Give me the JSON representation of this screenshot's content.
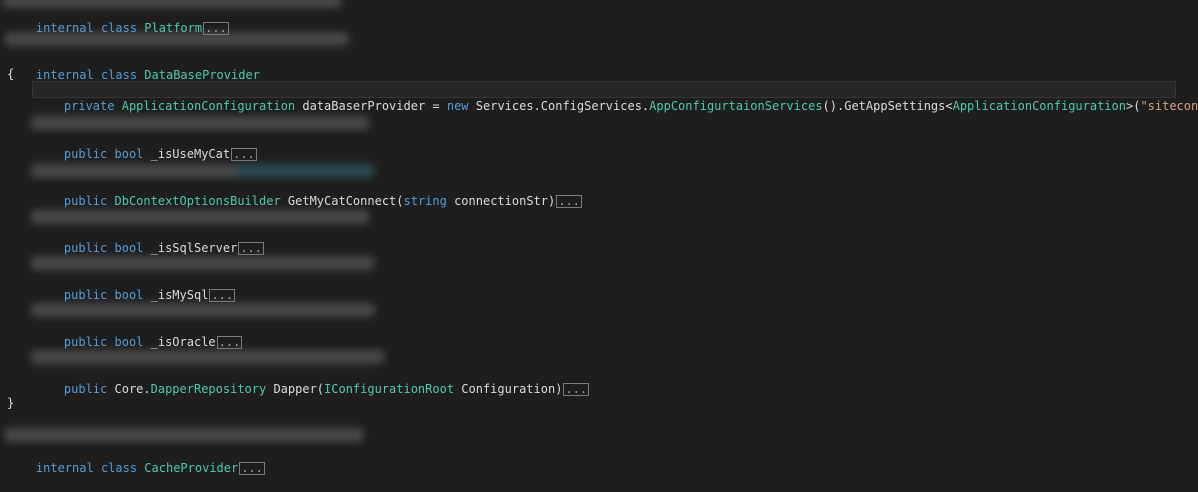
{
  "code": {
    "collapsed_marker": "...",
    "lines": {
      "platform": {
        "kw1": "internal",
        "kw2": "class",
        "name": "Platform"
      },
      "provider": {
        "kw1": "internal",
        "kw2": "class",
        "name": "DataBaseProvider"
      },
      "open_brace": "{",
      "field": {
        "kw": "private",
        "type": "ApplicationConfiguration",
        "var": "dataBaserProvider = ",
        "new_kw": "new",
        "ns": "Services.ConfigServices.",
        "cls": "AppConfigurtaionServices",
        "call": "().GetAppSettings<",
        "generic": "ApplicationConfiguration",
        "close": ">(",
        "arg": "\"siteconfig\"",
        "end": ");"
      },
      "use_mycat": {
        "kw1": "public",
        "kw2": "bool",
        "name": " _isUseMyCat"
      },
      "get_mycat": {
        "kw": "public",
        "type": "DbContextOptionsBuilder",
        "name": " GetMyCatConnect(",
        "param_kw": "string",
        "param": " connectionStr)"
      },
      "sqlserver": {
        "kw1": "public",
        "kw2": "bool",
        "name": " _isSqlServer"
      },
      "mysql": {
        "kw1": "public",
        "kw2": "bool",
        "name": " _isMySql"
      },
      "oracle": {
        "kw1": "public",
        "kw2": "bool",
        "name": " _isOracle"
      },
      "dapper": {
        "kw": "public",
        "ns": " Core.",
        "type": "DapperRepository",
        "name": " Dapper(",
        "param_type": "IConfigurationRoot",
        "param": " Configuration)"
      },
      "close_brace": "}",
      "cache": {
        "kw1": "internal",
        "kw2": "class",
        "name": "CacheProvider"
      }
    }
  },
  "colors": {
    "background": "#1e1e1e",
    "keyword": "#569cd6",
    "type": "#4ec9b0",
    "string": "#d69d85",
    "text": "#dcdcdc"
  }
}
